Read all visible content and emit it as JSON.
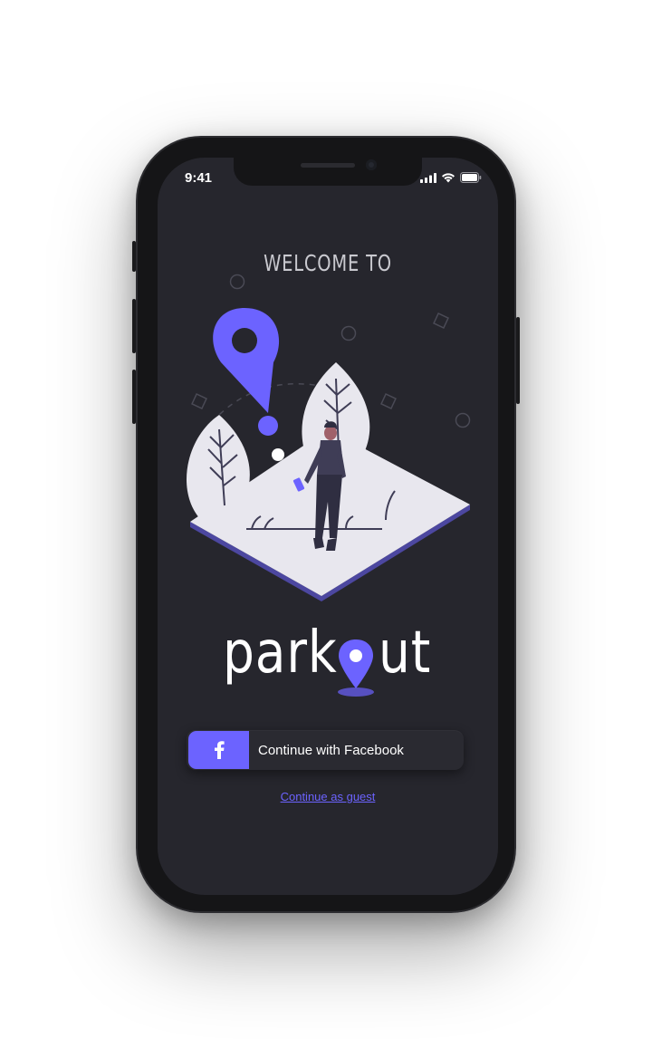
{
  "status_bar": {
    "time": "9:41",
    "icons": [
      "cellular-signal-icon",
      "wifi-icon",
      "battery-icon"
    ]
  },
  "welcome": {
    "title": "WELCOME TO"
  },
  "logo": {
    "text_before": "park",
    "text_after": "ut",
    "pin_icon": "location-pin-icon"
  },
  "actions": {
    "facebook_label": "Continue with Facebook",
    "facebook_icon": "facebook-f-icon",
    "guest_label": "Continue as guest"
  },
  "colors": {
    "accent": "#6c63ff",
    "screen_background": "#26262d",
    "text_primary": "#ffffff",
    "illustration_ground": "#e8e7ee"
  }
}
